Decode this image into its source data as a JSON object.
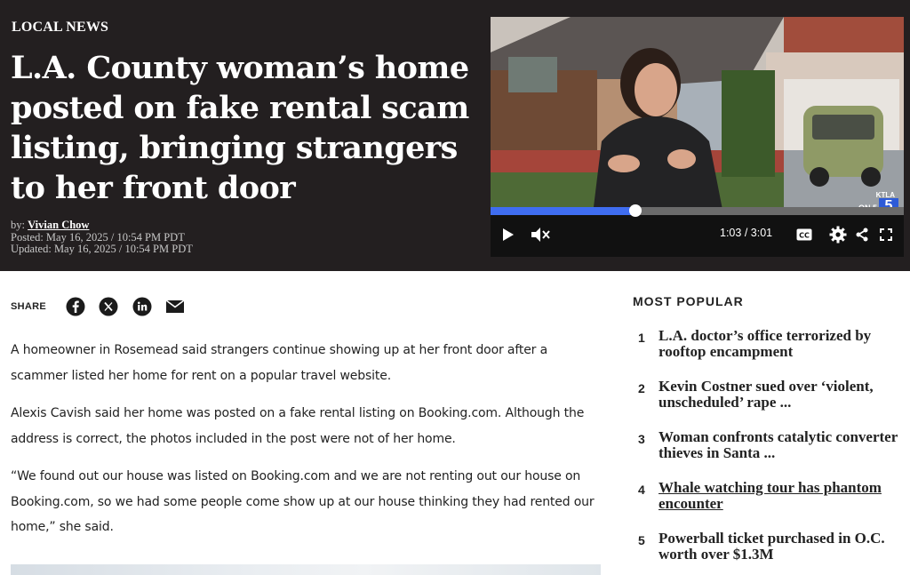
{
  "article": {
    "kicker": "LOCAL NEWS",
    "headline": "L.A. County woman’s home posted on fake rental scam listing, bringing strangers to her front door",
    "byline_prefix": "by: ",
    "author": "Vivian Chow",
    "posted": "Posted: May 16, 2025 / 10:54 PM PDT",
    "updated": "Updated: May 16, 2025 / 10:54 PM PDT",
    "paragraphs": [
      "A homeowner in Rosemead said strangers continue showing up at her front door after a scammer listed her home for rent on a popular travel website.",
      "Alexis Cavish said her home was posted on a fake rental listing on Booking.com. Although the address is correct, the photos included in the post were not of her home.",
      "“We found out our house was listed on Booking.com and we are not renting out our house on Booking.com, so we had some people come show up at our house thinking they had rented our home,” she said."
    ]
  },
  "video": {
    "current_time": "1:03",
    "separator": " / ",
    "duration": "3:01",
    "progress": 0.35,
    "station_badge": "KTLA",
    "channel_badge": "5",
    "on_label": "ON 5",
    "icons": [
      "play-icon",
      "mute-icon",
      "closed-captions-icon",
      "settings-icon",
      "share-icon",
      "fullscreen-icon"
    ]
  },
  "share": {
    "label": "SHARE",
    "icons": [
      "facebook-icon",
      "x-icon",
      "linkedin-icon",
      "email-icon"
    ]
  },
  "most_popular": {
    "title": "MOST POPULAR",
    "items": [
      {
        "rank": "1",
        "title": "L.A. doctor’s office terrorized by rooftop encampment"
      },
      {
        "rank": "2",
        "title": "Kevin Costner sued over ‘violent, unscheduled’ rape ..."
      },
      {
        "rank": "3",
        "title": "Woman confronts catalytic converter thieves in Santa ..."
      },
      {
        "rank": "4",
        "title": "Whale watching tour has phantom encounter"
      },
      {
        "rank": "5",
        "title": "Powerball ticket purchased in O.C. worth over $1.3M"
      }
    ]
  },
  "colors": {
    "hero_bg": "#231f20",
    "progress_fill": "#3f6df0",
    "ktla_blue": "#2d5bd8"
  }
}
